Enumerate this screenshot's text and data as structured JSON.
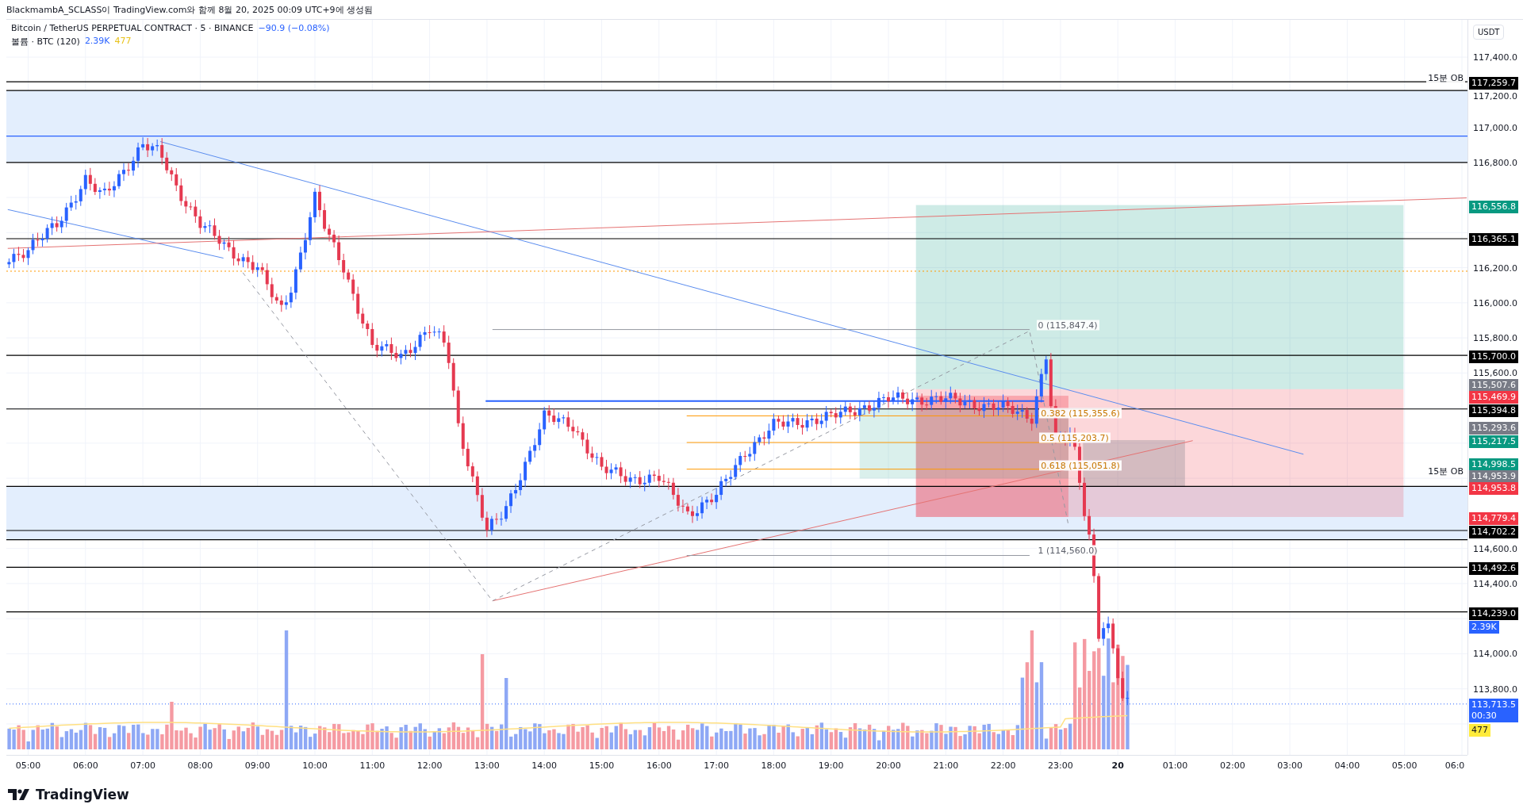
{
  "attribution": "BlackmambA_SCLASS이 TradingView.com와 함께 8월 20, 2025 00:09 UTC+9에 생성됨",
  "legend": {
    "symbol": "Bitcoin / TetherUS PERPETUAL CONTRACT · 5 · BINANCE",
    "change": "−90.9 (−0.08%)",
    "volume_label": "볼륨 · BTC (120)",
    "volume_values": [
      {
        "text": "2.39K",
        "color": "#2962ff"
      },
      {
        "text": "477",
        "color": "#e8c21a"
      }
    ]
  },
  "chart_labels": [
    {
      "kind": "zone",
      "text": "15분 OB"
    },
    {
      "kind": "zone",
      "text": "15분 OB"
    },
    {
      "kind": "fib-level",
      "text": "0 (115,847.4)"
    },
    {
      "kind": "fib-ratio",
      "text": "0.382 (115,355.6)"
    },
    {
      "kind": "fib-ratio",
      "text": "0.5 (115,203.7)"
    },
    {
      "kind": "fib-ratio",
      "text": "0.618 (115,051.8)"
    },
    {
      "kind": "fib-level",
      "text": "1 (114,560.0)"
    }
  ],
  "price_axis": {
    "currency": "USDT",
    "ticks": [
      "117,400.0",
      "117,200.0",
      "117,000.0",
      "116,800.0",
      "116,200.0",
      "116,000.0",
      "115,800.0",
      "115,600.0",
      "114,600.0",
      "114,400.0",
      "114,000.0",
      "113,800.0"
    ],
    "markers": [
      {
        "text": "117,259.7",
        "color": "#000000"
      },
      {
        "text": "116,556.8",
        "color": "#089981"
      },
      {
        "text": "116,365.1",
        "color": "#000000"
      },
      {
        "text": "115,700.0",
        "color": "#000000"
      },
      {
        "text": "115,507.6",
        "color": "#787b86"
      },
      {
        "text": "115,469.9",
        "color": "#f23645"
      },
      {
        "text": "115,394.8",
        "color": "#000000"
      },
      {
        "text": "115,293.6",
        "color": "#787b86"
      },
      {
        "text": "115,217.5",
        "color": "#089981"
      },
      {
        "text": "114,998.5",
        "color": "#089981"
      },
      {
        "text": "114,953.9",
        "color": "#787b86"
      },
      {
        "text": "114,953.8",
        "color": "#f23645"
      },
      {
        "text": "114,779.4",
        "color": "#f23645"
      },
      {
        "text": "114,702.2",
        "color": "#000000"
      },
      {
        "text": "114,492.6",
        "color": "#000000"
      },
      {
        "text": "114,239.0",
        "color": "#000000"
      },
      {
        "text": "2.39K",
        "color": "#2962ff"
      },
      {
        "text": "113,713.5",
        "countdown": "00:30",
        "color": "#2962ff"
      },
      {
        "text": "477",
        "color": "#ffeb3b"
      }
    ]
  },
  "time_axis": {
    "ticks": [
      {
        "text": "05:00",
        "kind": "time"
      },
      {
        "text": "06:00",
        "kind": "time"
      },
      {
        "text": "07:00",
        "kind": "time"
      },
      {
        "text": "08:00",
        "kind": "time"
      },
      {
        "text": "09:00",
        "kind": "time"
      },
      {
        "text": "10:00",
        "kind": "time"
      },
      {
        "text": "11:00",
        "kind": "time"
      },
      {
        "text": "12:00",
        "kind": "time"
      },
      {
        "text": "13:00",
        "kind": "time"
      },
      {
        "text": "14:00",
        "kind": "time"
      },
      {
        "text": "15:00",
        "kind": "time"
      },
      {
        "text": "16:00",
        "kind": "time"
      },
      {
        "text": "17:00",
        "kind": "time"
      },
      {
        "text": "18:00",
        "kind": "time"
      },
      {
        "text": "19:00",
        "kind": "time"
      },
      {
        "text": "20:00",
        "kind": "time"
      },
      {
        "text": "21:00",
        "kind": "time"
      },
      {
        "text": "22:00",
        "kind": "time"
      },
      {
        "text": "23:00",
        "kind": "time"
      },
      {
        "text": "20",
        "kind": "day"
      },
      {
        "text": "01:00",
        "kind": "time"
      },
      {
        "text": "02:00",
        "kind": "time"
      },
      {
        "text": "03:00",
        "kind": "time"
      },
      {
        "text": "04:00",
        "kind": "time"
      },
      {
        "text": "05:00",
        "kind": "time"
      },
      {
        "text": "06:0",
        "kind": "time"
      }
    ]
  },
  "footer": {
    "brand": "TradingView"
  }
}
